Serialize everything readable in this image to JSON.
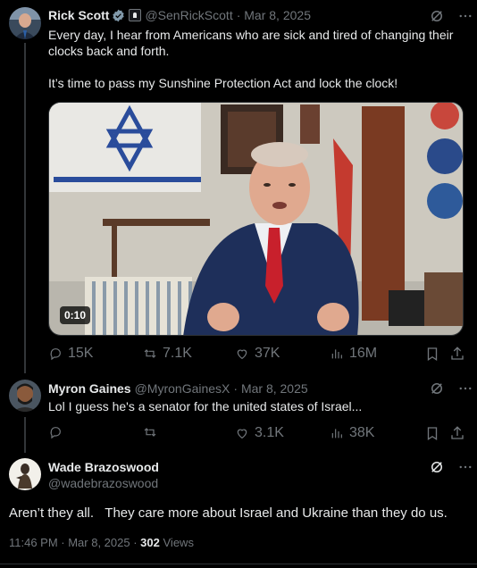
{
  "tweet1": {
    "name": "Rick Scott",
    "handle": "@SenRickScott",
    "date": "· Mar 8, 2025",
    "line1": "Every day, I hear from Americans who are sick and tired of changing their",
    "line2": "clocks back and forth.",
    "line3": "It’s time to pass my Sunshine Protection Act and lock the clock!",
    "video_duration": "0:10",
    "replies": "15K",
    "reposts": "7.1K",
    "likes": "37K",
    "views": "16M"
  },
  "tweet2": {
    "name": "Myron Gaines",
    "handle": "@MyronGainesX",
    "date": "· Mar 8, 2025",
    "text": "Lol I guess he's a senator for the united states of Israel...",
    "likes": "3.1K",
    "views": "38K"
  },
  "tweet3": {
    "name": "Wade Brazoswood",
    "handle": "@wadebrazoswood",
    "text": "Aren’t they all.   They care more about Israel and Ukraine than they do us.",
    "timestamp": "11:46 PM · Mar 8, 2025 ·",
    "view_count": "302",
    "views_label": "Views"
  },
  "icons": [
    "verified-check-icon",
    "government-badge-icon",
    "grok-icon",
    "more-icon",
    "reply-icon",
    "repost-icon",
    "like-icon",
    "views-icon",
    "bookmark-icon",
    "share-icon"
  ],
  "colors": {
    "background": "#000000",
    "text": "#e7e9ea",
    "muted": "#71767b",
    "verified": "#1d9bf0",
    "border": "#2f3336"
  }
}
